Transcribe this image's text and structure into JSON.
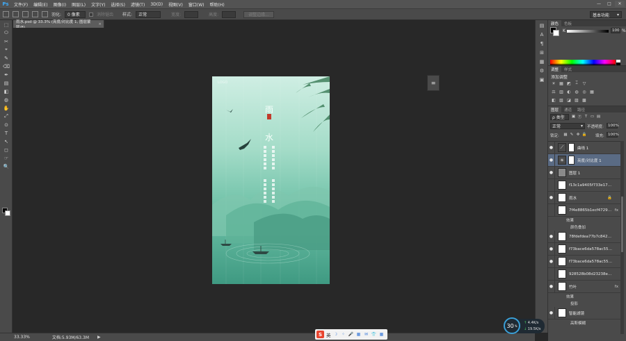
{
  "app": {
    "logo": "Ps",
    "menu": [
      "文件(F)",
      "编辑(E)",
      "图像(I)",
      "图层(L)",
      "文字(Y)",
      "选择(S)",
      "滤镜(T)",
      "3D(D)",
      "视图(V)",
      "窗口(W)",
      "帮助(H)"
    ],
    "window_controls": [
      "—",
      "□",
      "✕"
    ]
  },
  "options_bar": {
    "feather_label": "羽化:",
    "feather_value": "0 像素",
    "antialias_label": "消除锯齿",
    "style_label": "样式:",
    "style_value": "正常",
    "width_label": "宽度:",
    "height_label": "高度:",
    "refine_button": "调整边缘...",
    "workspace": "基本功能"
  },
  "document": {
    "tab_title": "雨水.psd @ 33.3% (亮度/对比度 1, 图层蒙版/8)",
    "close": "×"
  },
  "artwork": {
    "title_chars": [
      "雨",
      "水"
    ],
    "brand": "LOGO"
  },
  "mini_panel_icon": "≡",
  "color_panel": {
    "tabs": [
      "颜色",
      "色板"
    ],
    "channel": "K",
    "value": "100",
    "unit": "%"
  },
  "adjust_panel": {
    "tabs": [
      "调整",
      "样式"
    ],
    "title": "添加调整",
    "row1": [
      "☀",
      "▦",
      "◩",
      "⌶",
      "▽"
    ],
    "row2": [
      "⚖",
      "▥",
      "◐",
      "◍",
      "◎",
      "▦"
    ],
    "row3": [
      "◧",
      "▧",
      "◪",
      "▨",
      "▩"
    ]
  },
  "layers_panel": {
    "tabs": [
      "图层",
      "通道",
      "路径"
    ],
    "filter": "ρ 类型",
    "filter_icons": [
      "▣",
      "Ⓣ",
      "T",
      "▭",
      "▤"
    ],
    "blend_mode": "正常",
    "opacity_label": "不透明度:",
    "opacity": "100%",
    "lock_label": "锁定:",
    "lock_icons": [
      "▦",
      "✎",
      "✥",
      "🔒"
    ],
    "fill_label": "填充:",
    "fill": "100%",
    "layers": [
      {
        "kind": "adj",
        "name": "曲线 1",
        "icon": "⟋",
        "visible": true,
        "mask": true
      },
      {
        "kind": "adj",
        "name": "亮度/对比度 1",
        "icon": "☀",
        "visible": true,
        "mask": true,
        "selected": true
      },
      {
        "kind": "gray",
        "name": "图层 1",
        "visible": true
      },
      {
        "kind": "img",
        "name": "f13c1a9405f733e17e9b888...",
        "visible": false
      },
      {
        "kind": "img",
        "name": "雨水",
        "visible": true,
        "lock": "🔒"
      },
      {
        "kind": "img",
        "name": "7f4e8865b1ecf472989f...",
        "visible": false,
        "fx": "fx"
      },
      {
        "kind": "sub",
        "name": "效果"
      },
      {
        "kind": "sub2",
        "name": "颜色叠加"
      },
      {
        "kind": "img",
        "name": "78fdefdea77b7c842668c5f1...",
        "visible": true
      },
      {
        "kind": "img",
        "name": "f73bace6da578ac55b64efb...",
        "visible": true
      },
      {
        "kind": "img",
        "name": "f73bace6da578ac55b64efb...",
        "visible": true
      },
      {
        "kind": "img",
        "name": "928528b08d23238e7c5f9c88...",
        "visible": false
      },
      {
        "kind": "img",
        "name": "竹叶",
        "visible": true,
        "fx": "fx"
      },
      {
        "kind": "sub",
        "name": "效果"
      },
      {
        "kind": "sub2",
        "name": "投影"
      },
      {
        "kind": "img",
        "name": "智能滤镜",
        "visible": true
      },
      {
        "kind": "sub2",
        "name": "高斯模糊"
      }
    ]
  },
  "status": {
    "zoom": "33.33%",
    "doc_size": "文档:5.93M/63.3M",
    "arrow": "▶"
  },
  "ime": {
    "logo": "S",
    "mode": "英",
    "icons": [
      "☽",
      "⁘",
      "🎤",
      "▦",
      "✉",
      "👕",
      "▦"
    ]
  },
  "net_widget": {
    "percent": "30",
    "unit": "%",
    "up": "4.4",
    "up_unit": "K/s",
    "down": "19.5",
    "down_unit": "K/s"
  },
  "right_strip_icons": [
    "▤",
    "A",
    "¶",
    "⊞",
    "▦",
    "⚙",
    "▣"
  ],
  "tools": [
    "⬚",
    "⬭",
    "✂",
    "⌖",
    "✎",
    "⌫",
    "✒",
    "▤",
    "◧",
    "◍",
    "✋",
    "⤢",
    "⊙",
    "T",
    "↖",
    "◻",
    "☞",
    "🔍"
  ],
  "colors": {
    "accent": "#3fa9f5",
    "selected_layer": "#5a6b84",
    "panel_bg": "#4a4a4a",
    "canvas_bg": "#282828"
  }
}
